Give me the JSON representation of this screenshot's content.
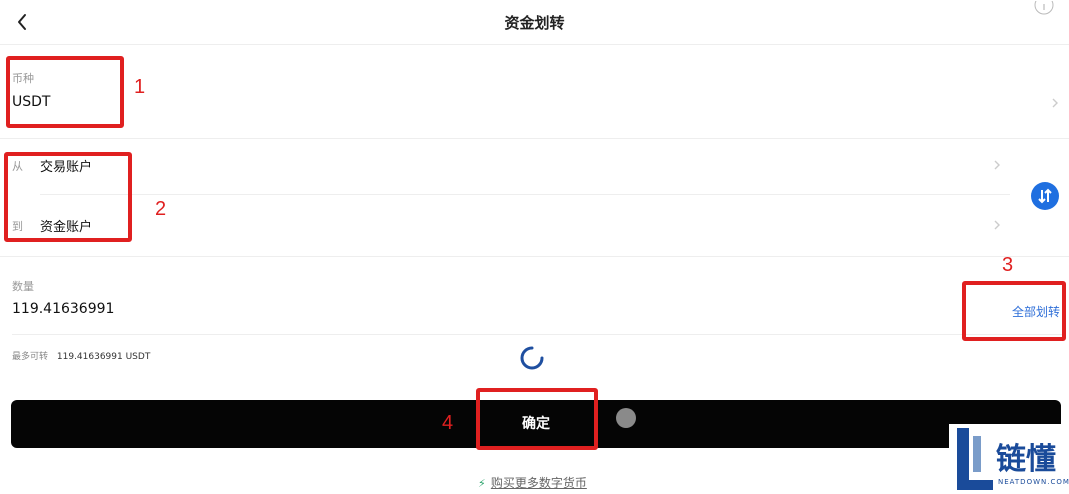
{
  "header": {
    "title": "资金划转"
  },
  "currency": {
    "label": "币种",
    "value": "USDT"
  },
  "transfer": {
    "from_label": "从",
    "from_value": "交易账户",
    "to_label": "到",
    "to_value": "资金账户"
  },
  "amount": {
    "label": "数量",
    "value": "119.41636991",
    "all_label": "全部划转",
    "max_prefix": "最多可转",
    "max_value": "119.41636991 USDT"
  },
  "confirm_label": "确定",
  "buy_more_label": "购买更多数字货币",
  "annotations": [
    "1",
    "2",
    "3",
    "4"
  ],
  "watermark": {
    "name": "链懂",
    "site": "NEATDOWN.COM"
  },
  "colors": {
    "accent": "#2f6fd8",
    "swap": "#1f6fe0",
    "annotation": "#e02020",
    "button": "#050505"
  },
  "icons": [
    "chevron-left-icon",
    "info-icon",
    "chevron-right-icon",
    "swap-arrows-icon",
    "loading-spinner-icon",
    "lightning-icon"
  ]
}
